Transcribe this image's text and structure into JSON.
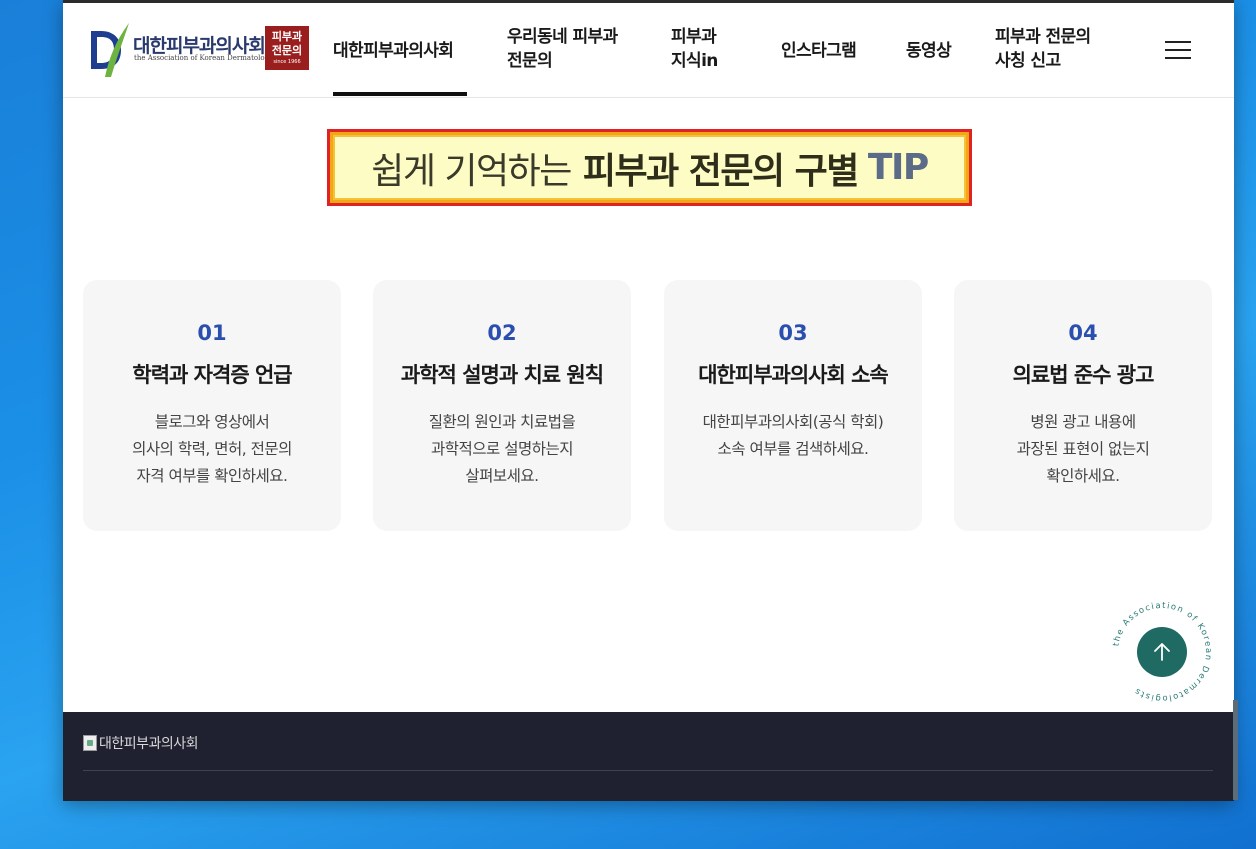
{
  "logo": {
    "name_kr": "대한피부과의사회",
    "name_en": "the Association of Korean Dermatologists",
    "badge_line1": "피부과",
    "badge_line2": "전문의",
    "badge_since": "since 1966"
  },
  "nav": {
    "items": [
      {
        "line1": "대한피부과의사회",
        "line2": ""
      },
      {
        "line1": "우리동네 피부과",
        "line2": "전문의"
      },
      {
        "line1": "피부과",
        "line2": "지식in"
      },
      {
        "line1": "인스타그램",
        "line2": ""
      },
      {
        "line1": "동영상",
        "line2": ""
      },
      {
        "line1": "피부과 전문의",
        "line2": "사칭 신고"
      }
    ]
  },
  "tip": {
    "light": "쉽게 기억하는",
    "bold": "피부과 전문의 구별",
    "accent": "TIP"
  },
  "cards": [
    {
      "num": "01",
      "title": "학력과 자격증 언급",
      "desc": [
        "블로그와 영상에서",
        "의사의 학력, 면허, 전문의",
        "자격 여부를 확인하세요."
      ]
    },
    {
      "num": "02",
      "title": "과학적 설명과 치료 원칙",
      "desc": [
        "질환의 원인과 치료법을",
        "과학적으로 설명하는지",
        "살펴보세요."
      ]
    },
    {
      "num": "03",
      "title": "대한피부과의사회 소속",
      "desc": [
        "대한피부과의사회(공식 학회)",
        "소속 여부를 검색하세요.",
        ""
      ]
    },
    {
      "num": "04",
      "title": "의료법 준수 광고",
      "desc": [
        "병원 광고 내용에",
        "과장된 표현이 없는지",
        "확인하세요."
      ]
    }
  ],
  "top_badge": {
    "ring_text": "the Association of Korean Dermatologists"
  },
  "footer": {
    "logo_alt": "대한피부과의사회"
  },
  "colors": {
    "accent_blue": "#2a4fae",
    "top_button": "#1f6a63",
    "footer_bg": "#1f2131",
    "badge_red": "#9b1e1e"
  },
  "icons": {
    "menu": "hamburger-icon",
    "scroll_top": "arrow-up-icon"
  }
}
